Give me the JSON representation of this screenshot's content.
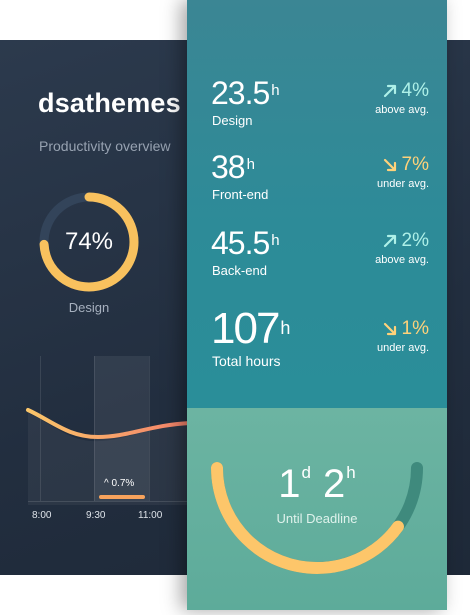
{
  "brand": "dsathemes",
  "subtitle": "Productivity overview",
  "overview": {
    "gauge": {
      "value": "74%",
      "label": "Design",
      "progress": 0.74
    },
    "chart": {
      "delta": "0.7%",
      "ticks": [
        "8:00",
        "9:30",
        "11:00"
      ]
    }
  },
  "stats": [
    {
      "value": "23.5",
      "unit": "h",
      "label": "Design",
      "delta": "4%",
      "trend": "up",
      "note": "above avg."
    },
    {
      "value": "38",
      "unit": "h",
      "label": "Front-end",
      "delta": "7%",
      "trend": "down",
      "note": "under avg."
    },
    {
      "value": "45.5",
      "unit": "h",
      "label": "Back-end",
      "delta": "2%",
      "trend": "up",
      "note": "above avg."
    },
    {
      "value": "107",
      "unit": "h",
      "label": "Total hours",
      "delta": "1%",
      "trend": "down",
      "note": "under avg."
    }
  ],
  "deadline": {
    "days": "1",
    "days_unit": "d",
    "hours": "2",
    "hours_unit": "h",
    "label": "Until Deadline",
    "progress": 0.8
  },
  "colors": {
    "accent_orange": "#f8b24f",
    "teal_top": "#2d8b98",
    "teal_bottom": "#5dab9a",
    "up": "#aef0e8",
    "down": "#ffd27a"
  }
}
